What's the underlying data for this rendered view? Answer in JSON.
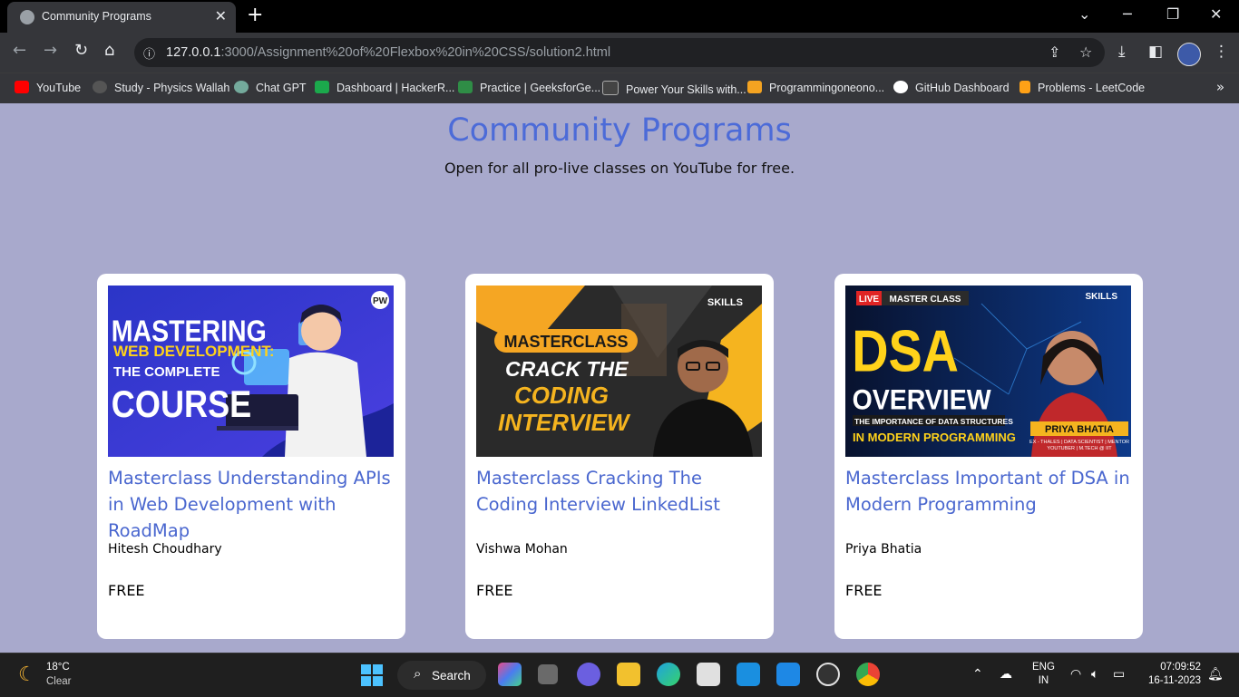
{
  "browser": {
    "tab_title": "Community Programs",
    "tab_close": "✕",
    "new_tab": "+",
    "url_host": "127.0.0.1",
    "url_rest": ":3000/Assignment%20of%20Flexbox%20in%20CSS/solution2.html",
    "bookmarks": [
      {
        "label": "YouTube",
        "color": "#ff0000"
      },
      {
        "label": "Study - Physics Wallah",
        "color": "#555555"
      },
      {
        "label": "Chat GPT",
        "color": "#74aa9c"
      },
      {
        "label": "Dashboard | HackerR...",
        "color": "#1ba94c"
      },
      {
        "label": "Practice | GeeksforGe...",
        "color": "#2f8d46"
      },
      {
        "label": "Power Your Skills with...",
        "color": "#444444"
      },
      {
        "label": "Programmingoneono...",
        "color": "#f4a321"
      },
      {
        "label": "GitHub Dashboard",
        "color": "#ffffff"
      },
      {
        "label": "Problems - LeetCode",
        "color": "#ffa116"
      }
    ],
    "bookmarks_more": "»"
  },
  "page": {
    "title": "Community Programs",
    "subtitle": "Open for all pro-live classes on YouTube for free."
  },
  "cards": [
    {
      "title": "Masterclass Understanding APIs in Web Development with RoadMap",
      "author": "Hitesh Choudhary",
      "price": "FREE",
      "thumb": {
        "l1": "MASTERING",
        "l2": "WEB DEVELOPMENT:",
        "l3": "THE COMPLETE",
        "l4": "COURSE",
        "badge": "PW"
      }
    },
    {
      "title": "Masterclass Cracking The Coding Interview LinkedList",
      "author": "Vishwa Mohan",
      "price": "FREE",
      "thumb": {
        "badge_label": "MASTERCLASS",
        "l1": "CRACK THE",
        "l2": "CODING",
        "l3": "INTERVIEW",
        "brand": "SKILLS"
      }
    },
    {
      "title": "Masterclass Important of DSA in Modern Programming",
      "author": "Priya Bhatia",
      "price": "FREE",
      "thumb": {
        "live": "LIVE",
        "masterclass": "MASTER CLASS",
        "brand": "SKILLS",
        "l1": "DSA",
        "l2": "OVERVIEW",
        "l3": "THE IMPORTANCE OF DATA STRUCTURES",
        "l4": "IN MODERN PROGRAMMING",
        "name": "PRIYA BHATIA",
        "role": "EX - THALES | DATA SCIENTIST | MENTOR",
        "role2": "YOUTUBER | M.TECH @ IIT"
      }
    }
  ],
  "taskbar": {
    "temp": "18°C",
    "condition": "Clear",
    "search": "Search",
    "lang1": "ENG",
    "lang2": "IN",
    "time": "07:09:52",
    "date": "16-11-2023"
  }
}
